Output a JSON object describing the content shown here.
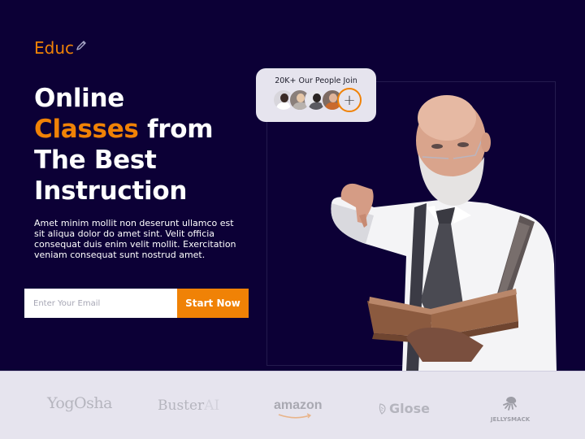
{
  "brand": {
    "name": "Educ",
    "icon": "pencil-icon",
    "accent_color": "#f08206",
    "background_color": "#0c0036"
  },
  "hero": {
    "headline": {
      "line1": "Online",
      "line2_accent": "Classes",
      "line2_rest": " from",
      "line3": "The Best",
      "line4": "Instruction"
    },
    "description": "Amet minim mollit non deserunt ullamco est sit aliqua dolor do amet sint. Velit officia consequat duis enim velit mollit. Exercitation veniam consequat sunt nostrud amet.",
    "email_input": {
      "placeholder": "Enter Your Email",
      "value": ""
    },
    "cta_label": "Start Now"
  },
  "join_card": {
    "title": "20K+ Our People Join",
    "avatars": [
      {
        "name": "member-avatar-1"
      },
      {
        "name": "member-avatar-2"
      },
      {
        "name": "member-avatar-3"
      },
      {
        "name": "member-avatar-4"
      }
    ],
    "add_label": "+"
  },
  "hero_image": {
    "description": "Bald bearded teacher with glasses, white shirt, tie and plaid suspenders, pointing forward and holding an open book"
  },
  "partners": [
    {
      "name": "Yog",
      "name_b": "Osha"
    },
    {
      "name": "Buster",
      "suffix": "AI"
    },
    {
      "name": "amazon"
    },
    {
      "name": "Glose"
    },
    {
      "name": "JELLYSMACK"
    }
  ]
}
